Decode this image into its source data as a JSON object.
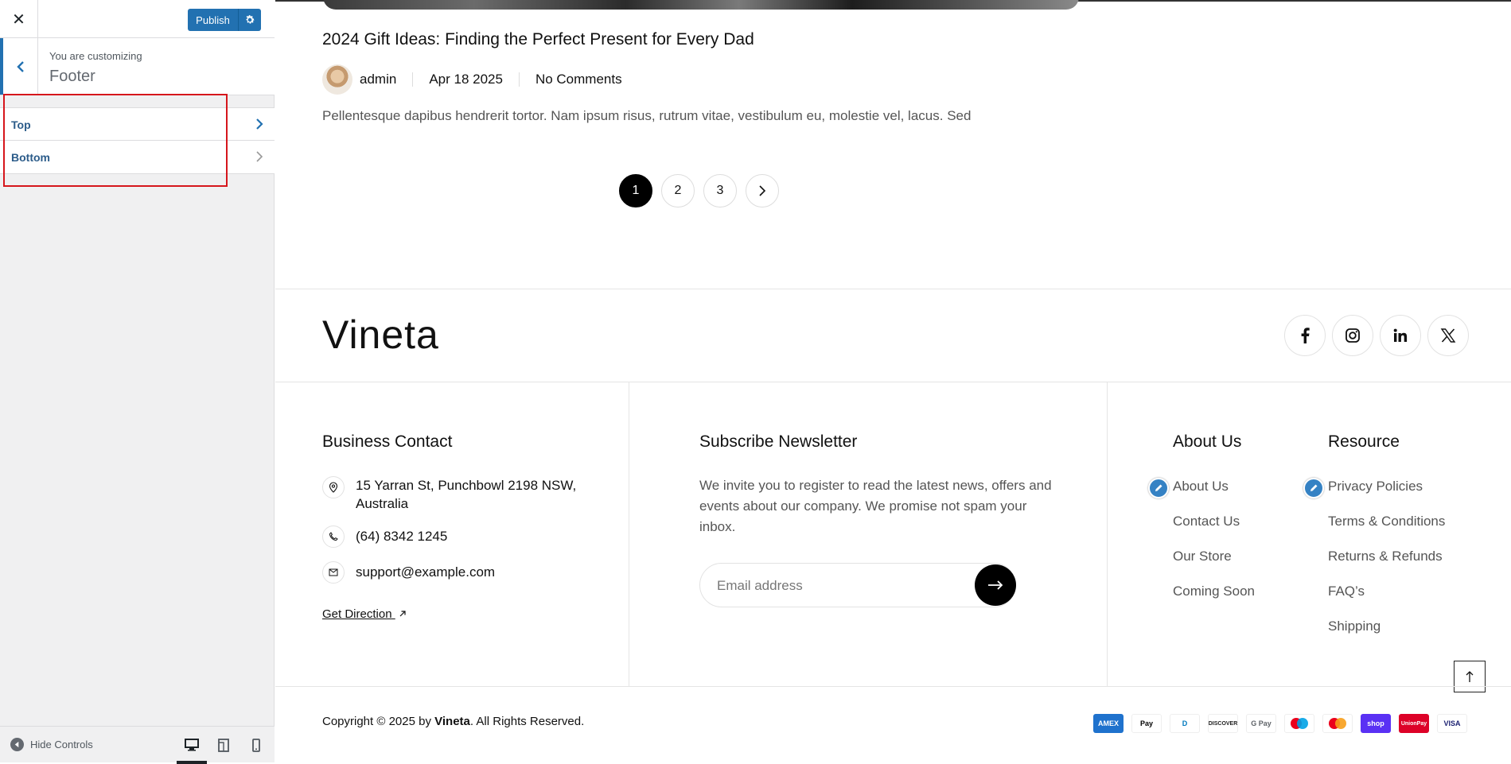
{
  "customizer": {
    "publish_label": "Publish",
    "customizing_label": "You are customizing",
    "section_title": "Footer",
    "items": [
      {
        "label": "Top"
      },
      {
        "label": "Bottom"
      }
    ],
    "hide_controls_label": "Hide Controls",
    "accent_color": "#2271b1",
    "highlight_color": "#d6161c"
  },
  "post": {
    "title": "2024 Gift Ideas: Finding the Perfect Present for Every Dad",
    "author": "admin",
    "date": "Apr 18 2025",
    "comments": "No Comments",
    "excerpt": "Pellentesque dapibus hendrerit tortor. Nam ipsum risus, rutrum vitae, vestibulum eu, molestie vel, lacus. Sed"
  },
  "pagination": {
    "pages": [
      "1",
      "2",
      "3"
    ],
    "active": "1"
  },
  "footer": {
    "logo": "Vineta",
    "social": [
      "facebook-icon",
      "instagram-icon",
      "linkedin-icon",
      "x-icon"
    ],
    "business_contact": {
      "heading": "Business Contact",
      "address": "15 Yarran St, Punchbowl 2198 NSW, Australia",
      "phone": "(64) 8342 1245",
      "email": "support@example.com",
      "direction_label": "Get Direction"
    },
    "newsletter": {
      "heading": "Subscribe Newsletter",
      "text": "We invite you to register to read the latest news, offers and events about our company. We promise not spam your inbox.",
      "placeholder": "Email address"
    },
    "about": {
      "heading": "About Us",
      "links": [
        "About Us",
        "Contact Us",
        "Our Store",
        "Coming Soon"
      ]
    },
    "resource": {
      "heading": "Resource",
      "links": [
        "Privacy Policies",
        "Terms & Conditions",
        "Returns & Refunds",
        "FAQ’s",
        "Shipping"
      ]
    },
    "copyright_prefix": "Copyright © 2025 by",
    "copyright_brand": "Vineta",
    "copyright_suffix": ". All Rights Reserved.",
    "payments": [
      {
        "name": "amex-icon",
        "label": "AMEX",
        "bg": "#1f72cd",
        "fg": "#ffffff"
      },
      {
        "name": "apple-pay-icon",
        "label": "Pay",
        "bg": "#ffffff",
        "fg": "#000000"
      },
      {
        "name": "diners-icon",
        "label": "D",
        "bg": "#ffffff",
        "fg": "#0079be"
      },
      {
        "name": "discover-icon",
        "label": "DISCOVER",
        "bg": "#ffffff",
        "fg": "#222222"
      },
      {
        "name": "google-pay-icon",
        "label": "G Pay",
        "bg": "#ffffff",
        "fg": "#5f6368"
      },
      {
        "name": "maestro-icon",
        "label": "",
        "bg": "#ffffff",
        "fg": "#000000"
      },
      {
        "name": "mastercard-icon",
        "label": "",
        "bg": "#ffffff",
        "fg": "#000000"
      },
      {
        "name": "shop-pay-icon",
        "label": "shop",
        "bg": "#5a31f4",
        "fg": "#ffffff"
      },
      {
        "name": "unionpay-icon",
        "label": "UnionPay",
        "bg": "#dd0228",
        "fg": "#ffffff"
      },
      {
        "name": "visa-icon",
        "label": "VISA",
        "bg": "#ffffff",
        "fg": "#1a1f71"
      }
    ]
  }
}
